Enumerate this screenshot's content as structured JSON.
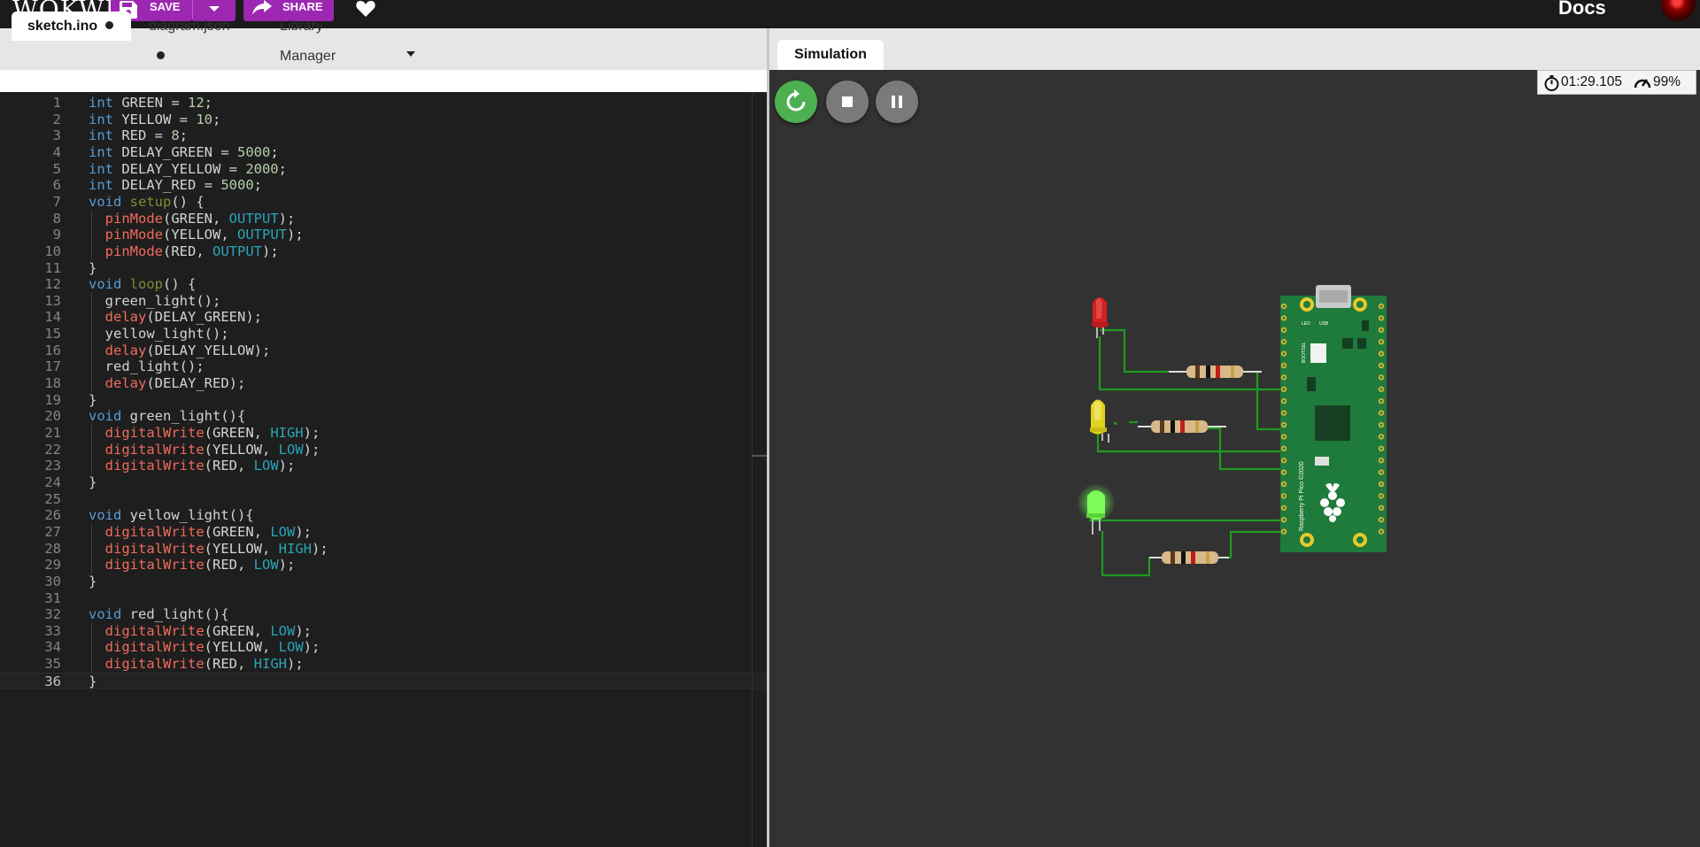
{
  "topbar": {
    "logo": "WOKWI",
    "save_label": "SAVE",
    "share_label": "SHARE",
    "docs_label": "Docs",
    "accent_color": "#9c27b0"
  },
  "editor": {
    "tabs": [
      {
        "label": "sketch.ino",
        "modified": true,
        "active": true
      },
      {
        "label": "diagram.json",
        "modified": true,
        "active": false
      },
      {
        "label": "Library Manager",
        "active": false
      }
    ],
    "lines": [
      {
        "n": "1",
        "text": "int GREEN = 12;"
      },
      {
        "n": "2",
        "text": "int YELLOW = 10;"
      },
      {
        "n": "3",
        "text": "int RED = 8;"
      },
      {
        "n": "4",
        "text": "int DELAY_GREEN = 5000;"
      },
      {
        "n": "5",
        "text": "int DELAY_YELLOW = 2000;"
      },
      {
        "n": "6",
        "text": "int DELAY_RED = 5000;"
      },
      {
        "n": "7",
        "text": "void setup() {"
      },
      {
        "n": "8",
        "text": "  pinMode(GREEN, OUTPUT);"
      },
      {
        "n": "9",
        "text": "  pinMode(YELLOW, OUTPUT);"
      },
      {
        "n": "10",
        "text": "  pinMode(RED, OUTPUT);"
      },
      {
        "n": "11",
        "text": "}"
      },
      {
        "n": "12",
        "text": "void loop() {"
      },
      {
        "n": "13",
        "text": "  green_light();"
      },
      {
        "n": "14",
        "text": "  delay(DELAY_GREEN);"
      },
      {
        "n": "15",
        "text": "  yellow_light();"
      },
      {
        "n": "16",
        "text": "  delay(DELAY_YELLOW);"
      },
      {
        "n": "17",
        "text": "  red_light();"
      },
      {
        "n": "18",
        "text": "  delay(DELAY_RED);"
      },
      {
        "n": "19",
        "text": "}"
      },
      {
        "n": "20",
        "text": "void green_light(){"
      },
      {
        "n": "21",
        "text": "  digitalWrite(GREEN, HIGH);"
      },
      {
        "n": "22",
        "text": "  digitalWrite(YELLOW, LOW);"
      },
      {
        "n": "23",
        "text": "  digitalWrite(RED, LOW);"
      },
      {
        "n": "24",
        "text": "}"
      },
      {
        "n": "25",
        "text": ""
      },
      {
        "n": "26",
        "text": "void yellow_light(){"
      },
      {
        "n": "27",
        "text": "  digitalWrite(GREEN, LOW);"
      },
      {
        "n": "28",
        "text": "  digitalWrite(YELLOW, HIGH);"
      },
      {
        "n": "29",
        "text": "  digitalWrite(RED, LOW);"
      },
      {
        "n": "30",
        "text": "}"
      },
      {
        "n": "31",
        "text": ""
      },
      {
        "n": "32",
        "text": "void red_light(){"
      },
      {
        "n": "33",
        "text": "  digitalWrite(GREEN, LOW);"
      },
      {
        "n": "34",
        "text": "  digitalWrite(YELLOW, LOW);"
      },
      {
        "n": "35",
        "text": "  digitalWrite(RED, HIGH);"
      },
      {
        "n": "36",
        "text": "}"
      }
    ],
    "current_line": "36"
  },
  "simulation": {
    "tab_label": "Simulation",
    "elapsed_time": "01:29.105",
    "speed": "99%",
    "controls": [
      "restart-icon",
      "stop-icon",
      "pause-icon"
    ],
    "components": {
      "board": "Raspberry Pi Pico",
      "board_marking": "Raspberry Pi Pico ©2020",
      "board_labels": [
        "USB",
        "LED",
        "BOOTSEL"
      ],
      "leds": [
        {
          "color": "red",
          "lit": false
        },
        {
          "color": "yellow",
          "lit": false
        },
        {
          "color": "green",
          "lit": true
        }
      ],
      "resistors": 3,
      "wire_color": "#1f9a1f",
      "board_color": "#1e7b3b"
    }
  }
}
